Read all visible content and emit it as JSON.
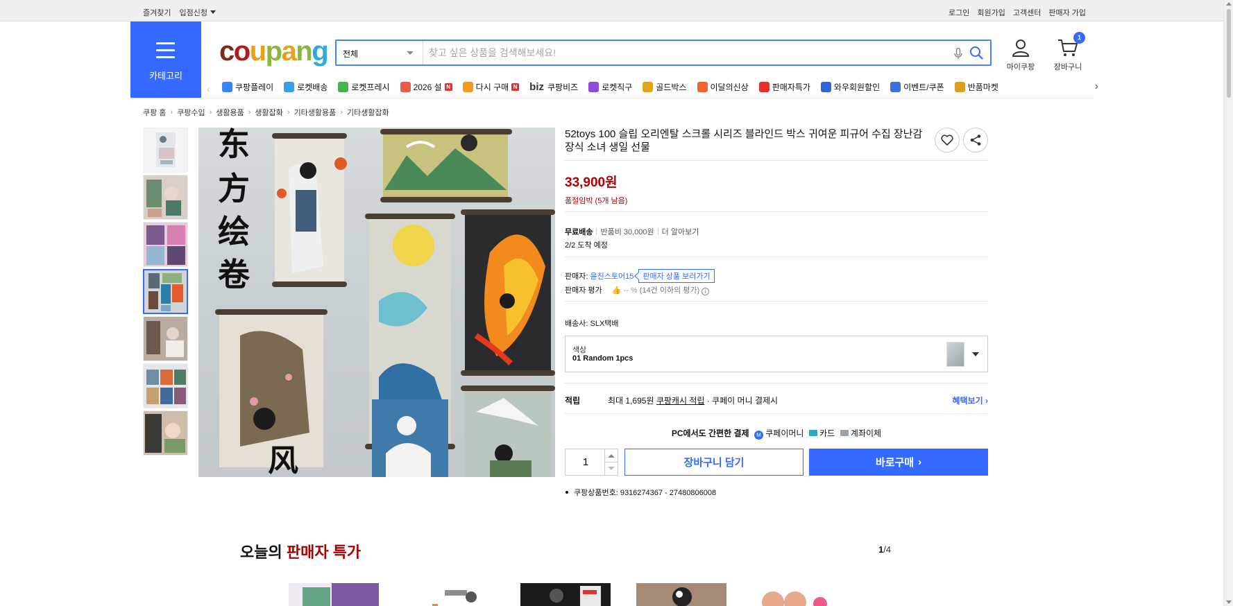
{
  "topbar": {
    "left": [
      "즐겨찾기",
      "입점신청"
    ],
    "right": [
      "로그인",
      "회원가입",
      "고객센터",
      "판매자 가입"
    ]
  },
  "header": {
    "category_label": "카테고리",
    "logo_text": [
      "c",
      "o",
      "u",
      "p",
      "a",
      "n",
      "g"
    ],
    "search_scope": "전체",
    "search_placeholder": "찾고 싶은 상품을 검색해보세요!",
    "mycoupang_label": "마이쿠팡",
    "cart_label": "장바구니",
    "cart_count": "1"
  },
  "nav": {
    "items": [
      {
        "label": "쿠팡플레이",
        "icon": "play-icon",
        "color": "#3b82f6"
      },
      {
        "label": "로켓배송",
        "icon": "rocket-icon",
        "color": "#3aa0e6"
      },
      {
        "label": "로켓프레시",
        "icon": "rocket-fresh-icon",
        "color": "#43b54b"
      },
      {
        "label": "2026 설",
        "icon": "gift-icon",
        "color": "#e85d4a",
        "badge": "N"
      },
      {
        "label": "다시 구매",
        "icon": "reorder-icon",
        "color": "#f39a1e",
        "badge": "N"
      },
      {
        "label": "쿠팡비즈",
        "icon": "biz-icon",
        "prefix": "biz"
      },
      {
        "label": "로켓직구",
        "icon": "global-icon",
        "color": "#8e4bd8"
      },
      {
        "label": "골드박스",
        "icon": "goldbox-icon",
        "color": "#e0a51b"
      },
      {
        "label": "이달의신상",
        "icon": "new-icon",
        "color": "#f0632b"
      },
      {
        "label": "판매자특가",
        "icon": "seller-deal-icon",
        "color": "#e2322a"
      },
      {
        "label": "와우회원할인",
        "icon": "wow-icon",
        "color": "#2f63d6"
      },
      {
        "label": "이벤트/쿠폰",
        "icon": "coupon-icon",
        "color": "#3d6fe0"
      },
      {
        "label": "반품마켓",
        "icon": "return-market-icon",
        "color": "#d9a025"
      }
    ]
  },
  "breadcrumb": [
    "쿠팡 홈",
    "쿠팡수입",
    "생활용품",
    "생활잡화",
    "기타생활용품",
    "기타생활잡화"
  ],
  "product": {
    "title": "52toys 100 슬립 오리엔탈 스크롤 시리즈 블라인드 박스 귀여운 피규어 수집 장난감 장식 소녀 생일 선물",
    "price": "33,900원",
    "stock_status": "품절임박 (5개 남음)",
    "shipping": {
      "free": "무료배송",
      "return_fee": "반품비 30,000원",
      "more": "더 알아보기",
      "arrival": "2/2 도착 예정"
    },
    "seller": {
      "label": "판매자:",
      "name": "윤진스토어15",
      "button": "판매자 상품 보러가기",
      "rating_label": "판매자 평가",
      "rating_value": "-- %",
      "rating_note": "(14건 이하의 평가)"
    },
    "carrier": {
      "label": "배송사:",
      "name": "SLX택배"
    },
    "option": {
      "label": "색상",
      "value": "01 Random 1pcs"
    },
    "reward": {
      "label": "적립",
      "text_prefix": "최대 1,695원",
      "cash_link": "쿠팡캐시 적립",
      "text_suffix": "· 쿠페이 머니 결제시",
      "benefit_link": "혜택보기"
    },
    "payment": {
      "label": "PC에서도 간편한 결제",
      "methods": [
        "쿠페이머니",
        "카드",
        "계좌이체"
      ]
    },
    "quantity": "1",
    "cart_button": "장바구니 담기",
    "buy_button": "바로구매",
    "product_number": "쿠팡상품번호: 9316274367 - 27480806008"
  },
  "today": {
    "title_prefix": "오늘의",
    "title_highlight": "판매자 특가",
    "page_current": "1",
    "page_total": "/4"
  }
}
